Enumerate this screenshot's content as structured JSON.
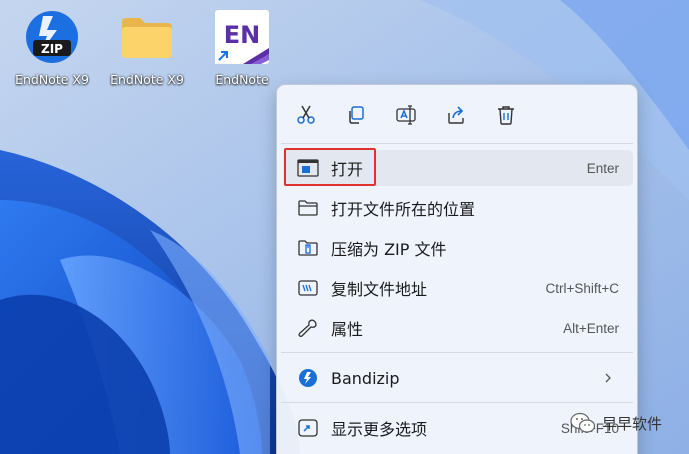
{
  "desktop": {
    "icons": [
      {
        "label": "EndNote X9",
        "icon": "zip-archive-icon"
      },
      {
        "label": "EndNote X9",
        "icon": "folder-icon"
      },
      {
        "label": "EndNote",
        "icon": "endnote-app-icon",
        "glyph_text": "EN"
      }
    ]
  },
  "menu": {
    "toolbar": [
      {
        "name": "cut",
        "icon": "scissors-icon"
      },
      {
        "name": "copy",
        "icon": "copy-icon"
      },
      {
        "name": "rename",
        "icon": "rename-icon"
      },
      {
        "name": "share",
        "icon": "share-icon"
      },
      {
        "name": "delete",
        "icon": "trash-icon"
      }
    ],
    "items": [
      {
        "label": "打开",
        "shortcut": "Enter",
        "icon": "open-window-icon"
      },
      {
        "label": "打开文件所在的位置",
        "shortcut": "",
        "icon": "folder-outline-icon"
      },
      {
        "label": "压缩为 ZIP 文件",
        "shortcut": "",
        "icon": "zip-folder-icon"
      },
      {
        "label": "复制文件地址",
        "shortcut": "Ctrl+Shift+C",
        "icon": "copy-path-icon"
      },
      {
        "label": "属性",
        "shortcut": "Alt+Enter",
        "icon": "wrench-icon"
      },
      {
        "label": "Bandizip",
        "shortcut": "",
        "icon": "bandizip-icon"
      },
      {
        "label": "显示更多选项",
        "shortcut": "Shift+F10",
        "icon": "more-options-icon"
      }
    ]
  },
  "watermark": {
    "text": "早早软件",
    "icon": "wechat-icon"
  },
  "colors": {
    "accent": "#1a6fd6",
    "highlight_border": "#e0312e",
    "menu_bg": "#f1f5fc"
  }
}
